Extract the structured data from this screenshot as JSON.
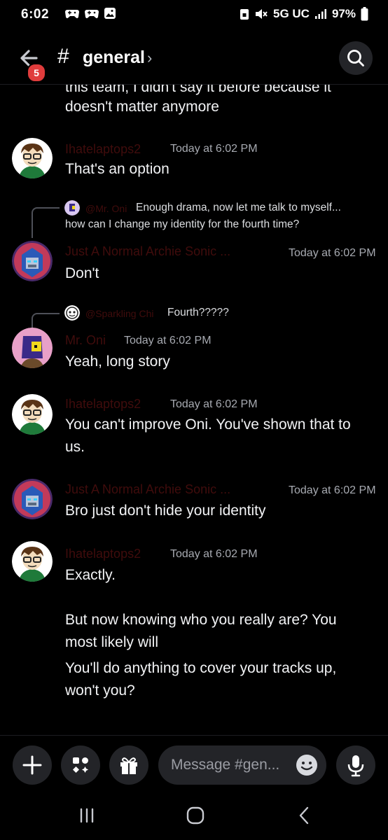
{
  "status_bar": {
    "time": "6:02",
    "network": "5G UC",
    "battery": "97%"
  },
  "header": {
    "back_badge": "5",
    "hash": "#",
    "channel_name": "general",
    "chevron": "›"
  },
  "messages": [
    {
      "type": "continuation",
      "lines": [
        "this team, I didn't say it before because it",
        "doesn't matter anymore"
      ]
    },
    {
      "author": "Ihatelaptops2",
      "timestamp": "Today at 6:02 PM",
      "avatar": "brown-hair-glasses-avatar",
      "lines": [
        "That's an option"
      ]
    },
    {
      "reply": {
        "name": "@Mr. Oni",
        "text": "Enough drama, now let me talk to myself...",
        "text2": "how can I change my identity for the fourth time?"
      },
      "author": "Just A Normal Archie Sonic ...",
      "timestamp": "Today at 6:02 PM",
      "avatar": "robot-avatar",
      "lines": [
        "Don't"
      ]
    },
    {
      "reply": {
        "name": "@Sparkling Chi",
        "text": "Fourth?????"
      },
      "author": "Mr. Oni",
      "timestamp": "Today at 6:02 PM",
      "avatar": "oni-avatar",
      "lines": [
        "Yeah, long story"
      ]
    },
    {
      "author": "Ihatelaptops2",
      "timestamp": "Today at 6:02 PM",
      "avatar": "brown-hair-glasses-avatar",
      "lines": [
        "You can't improve Oni. You've shown that to",
        "us."
      ]
    },
    {
      "author": "Just A Normal Archie Sonic ...",
      "timestamp": "Today at 6:02 PM",
      "avatar": "robot-avatar",
      "lines": [
        "Bro just don't hide your identity"
      ]
    },
    {
      "author": "Ihatelaptops2",
      "timestamp": "Today at 6:02 PM",
      "avatar": "brown-hair-glasses-avatar",
      "lines": [
        "Exactly."
      ],
      "extra": [
        [
          "But now knowing who you really are? You",
          "most likely will"
        ],
        [
          "You'll do anything to cover your tracks up,",
          "won't you?"
        ]
      ]
    }
  ],
  "composer": {
    "placeholder": "Message #gen...",
    "add_icon": "plus-icon",
    "apps_icon": "apps-icon",
    "gift_icon": "gift-icon",
    "emoji_icon": "emoji-icon",
    "mic_icon": "microphone-icon"
  },
  "colors": {
    "background": "#000000",
    "author_name": "#400c0c",
    "timestamp": "#a7aab1",
    "badge": "#e03c3c",
    "button_bg": "#232428"
  }
}
